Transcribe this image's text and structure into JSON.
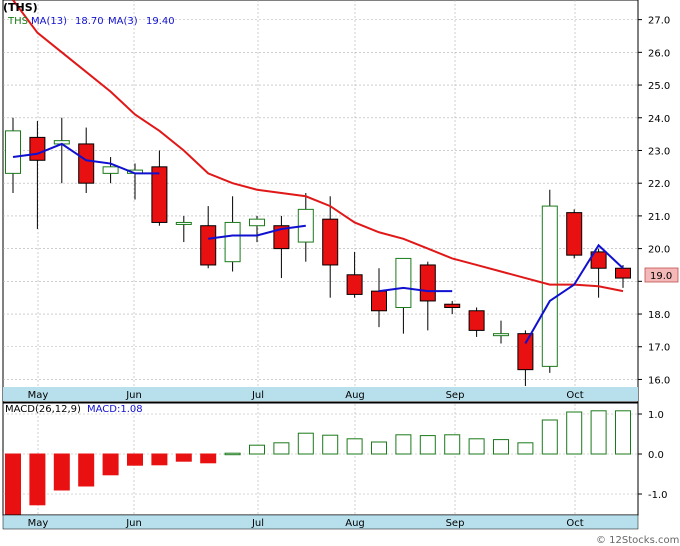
{
  "ticker_label": "(THS)",
  "watermark": "© 12Stocks.com",
  "price_panel": {
    "legend": {
      "symbol": "THS",
      "ma13_label": "MA(13)",
      "ma13_value": "18.70",
      "ma3_label": "MA(3)",
      "ma3_value": "19.40"
    },
    "last_price_tag": "19.0",
    "y_ticks": [
      "16.0",
      "17.0",
      "18.0",
      "19.0",
      "20.0",
      "21.0",
      "22.0",
      "23.0",
      "24.0",
      "25.0",
      "26.0",
      "27.0"
    ],
    "month_labels": [
      "May",
      "Jun",
      "Jul",
      "Aug",
      "Sep",
      "Oct"
    ]
  },
  "macd_panel": {
    "legend": {
      "label": "MACD(26,12,9)",
      "value_label": "MACD:1.08"
    },
    "y_ticks": [
      "-1.0",
      "0.0",
      "1.0"
    ],
    "month_labels": [
      "May",
      "Jun",
      "Jul",
      "Aug",
      "Sep",
      "Oct"
    ]
  },
  "colors": {
    "up": "#ffffff",
    "down": "#e81010",
    "up_border": "#1a7a1a",
    "ma13": "#e01818",
    "ma3": "#1010d0",
    "axis_band": "#b8e0ec",
    "grid": "#b0b0b0",
    "price_tag": "#f4b8b8"
  },
  "chart_data": [
    {
      "type": "candlestick",
      "ylim": [
        15.8,
        27.6
      ],
      "months": [
        "May",
        "Jun",
        "Jul",
        "Aug",
        "Sep",
        "Oct"
      ],
      "candles": [
        {
          "o": 22.3,
          "h": 24.0,
          "l": 21.7,
          "c": 23.6
        },
        {
          "o": 23.4,
          "h": 23.9,
          "l": 20.6,
          "c": 22.7
        },
        {
          "o": 23.2,
          "h": 24.0,
          "l": 22.0,
          "c": 23.3
        },
        {
          "o": 23.2,
          "h": 23.7,
          "l": 21.7,
          "c": 22.0
        },
        {
          "o": 22.3,
          "h": 22.8,
          "l": 22.0,
          "c": 22.5
        },
        {
          "o": 22.3,
          "h": 22.6,
          "l": 21.5,
          "c": 22.4
        },
        {
          "o": 22.5,
          "h": 23.0,
          "l": 20.7,
          "c": 20.8
        },
        {
          "o": 20.8,
          "h": 21.0,
          "l": 20.2,
          "c": 20.8
        },
        {
          "o": 20.7,
          "h": 21.3,
          "l": 19.4,
          "c": 19.5
        },
        {
          "o": 19.6,
          "h": 21.6,
          "l": 19.3,
          "c": 20.8
        },
        {
          "o": 20.7,
          "h": 21.0,
          "l": 20.2,
          "c": 20.9
        },
        {
          "o": 20.7,
          "h": 21.0,
          "l": 19.1,
          "c": 20.0
        },
        {
          "o": 20.2,
          "h": 21.7,
          "l": 19.6,
          "c": 21.2
        },
        {
          "o": 20.9,
          "h": 21.6,
          "l": 18.5,
          "c": 19.5
        },
        {
          "o": 19.2,
          "h": 19.9,
          "l": 18.5,
          "c": 18.6
        },
        {
          "o": 18.7,
          "h": 19.4,
          "l": 17.6,
          "c": 18.1
        },
        {
          "o": 18.2,
          "h": 19.7,
          "l": 17.4,
          "c": 19.7
        },
        {
          "o": 19.5,
          "h": 19.6,
          "l": 17.5,
          "c": 18.4
        },
        {
          "o": 18.3,
          "h": 18.4,
          "l": 18.0,
          "c": 18.2
        },
        {
          "o": 18.1,
          "h": 18.2,
          "l": 17.3,
          "c": 17.5
        },
        {
          "o": 17.4,
          "h": 17.8,
          "l": 17.1,
          "c": 17.4
        },
        {
          "o": 17.4,
          "h": 17.5,
          "l": 15.8,
          "c": 16.3
        },
        {
          "o": 16.4,
          "h": 21.8,
          "l": 16.2,
          "c": 21.3
        },
        {
          "o": 21.1,
          "h": 21.2,
          "l": 19.7,
          "c": 19.8
        },
        {
          "o": 19.9,
          "h": 20.0,
          "l": 18.5,
          "c": 19.4
        },
        {
          "o": 19.4,
          "h": 19.5,
          "l": 18.8,
          "c": 19.1
        }
      ],
      "ma13": [
        27.6,
        26.6,
        26.0,
        25.4,
        24.8,
        24.1,
        23.6,
        23.0,
        22.3,
        22.0,
        21.8,
        21.7,
        21.6,
        21.3,
        20.8,
        20.5,
        20.3,
        20.0,
        19.7,
        19.5,
        19.3,
        19.1,
        18.9,
        18.9,
        18.85,
        18.7
      ],
      "ma3": [
        22.8,
        22.9,
        23.2,
        22.7,
        22.6,
        22.3,
        22.3,
        null,
        20.3,
        20.4,
        20.4,
        20.6,
        20.7,
        null,
        null,
        18.7,
        18.8,
        18.7,
        18.7,
        null,
        null,
        17.1,
        18.4,
        18.9,
        20.1,
        19.4
      ],
      "last_value": 19.0
    },
    {
      "type": "bar",
      "title": "MACD(26,12,9)",
      "ylim": [
        -1.5,
        1.25
      ],
      "values": [
        -1.55,
        -1.27,
        -0.9,
        -0.8,
        -0.52,
        -0.28,
        -0.27,
        -0.18,
        -0.22,
        0.02,
        0.22,
        0.28,
        0.52,
        0.47,
        0.38,
        0.3,
        0.48,
        0.46,
        0.48,
        0.38,
        0.36,
        0.28,
        0.85,
        1.05,
        1.08,
        1.08
      ]
    }
  ]
}
